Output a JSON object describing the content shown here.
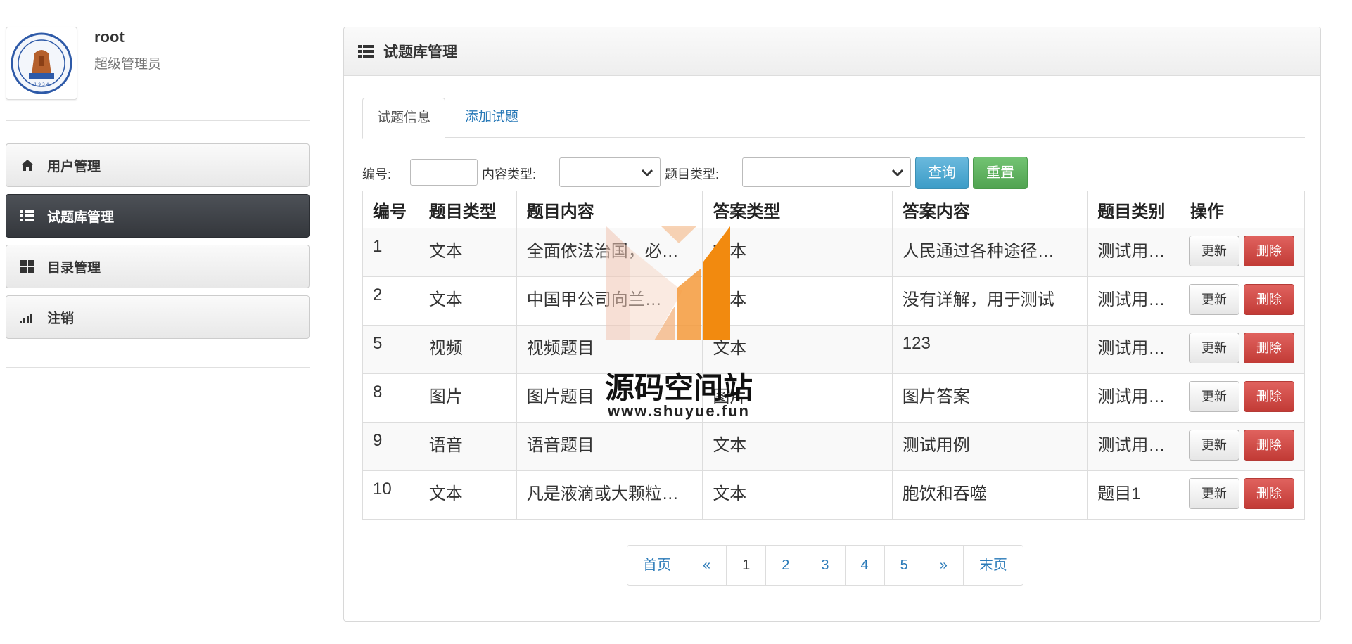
{
  "user": {
    "name": "root",
    "role": "超级管理员",
    "avatar": "school-emblem"
  },
  "sidebar": {
    "items": [
      {
        "label": "用户管理",
        "icon": "home-icon",
        "active": false
      },
      {
        "label": "试题库管理",
        "icon": "list-icon",
        "active": true
      },
      {
        "label": "目录管理",
        "icon": "grid-icon",
        "active": false
      },
      {
        "label": "注销",
        "icon": "signal-icon",
        "active": false
      }
    ]
  },
  "panel": {
    "title": "试题库管理"
  },
  "tabs": [
    {
      "label": "试题信息",
      "active": true
    },
    {
      "label": "添加试题",
      "active": false
    }
  ],
  "filter": {
    "id_label": "编号:",
    "id_value": "",
    "content_type_label": "内容类型:",
    "content_type_value": "",
    "question_type_label": "题目类型:",
    "question_type_value": "",
    "query_button": "查询",
    "reset_button": "重置"
  },
  "table": {
    "headers": [
      "编号",
      "题目类型",
      "题目内容",
      "答案类型",
      "答案内容",
      "题目类别",
      "操作"
    ],
    "rows": [
      [
        "1",
        "文本",
        "全面依法治国，必…",
        "文本",
        "人民通过各种途径…",
        "测试用…"
      ],
      [
        "2",
        "文本",
        "中国甲公司向兰…",
        "文本",
        "没有详解，用于测试",
        "测试用…"
      ],
      [
        "5",
        "视频",
        "视频题目",
        "文本",
        "123",
        "测试用…"
      ],
      [
        "8",
        "图片",
        "图片题目",
        "图片",
        "图片答案",
        "测试用…"
      ],
      [
        "9",
        "语音",
        "语音题目",
        "文本",
        "测试用例",
        "测试用…"
      ],
      [
        "10",
        "文本",
        "凡是液滴或大颗粒…",
        "文本",
        "胞饮和吞噬",
        "题目1"
      ]
    ],
    "update_label": "更新",
    "delete_label": "删除"
  },
  "pagination": {
    "first": "首页",
    "prev": "«",
    "pages": [
      "1",
      "2",
      "3",
      "4",
      "5"
    ],
    "current": "1",
    "next": "»",
    "last": "末页"
  },
  "watermark": {
    "title": "源码空间站",
    "url": "www.shuyue.fun"
  },
  "colors": {
    "accent_link": "#2a7ab8",
    "active_menu": "#3a3d42",
    "query_btn": "#4aa7d1",
    "reset_btn": "#5cb85c",
    "delete_btn": "#d9534f"
  }
}
